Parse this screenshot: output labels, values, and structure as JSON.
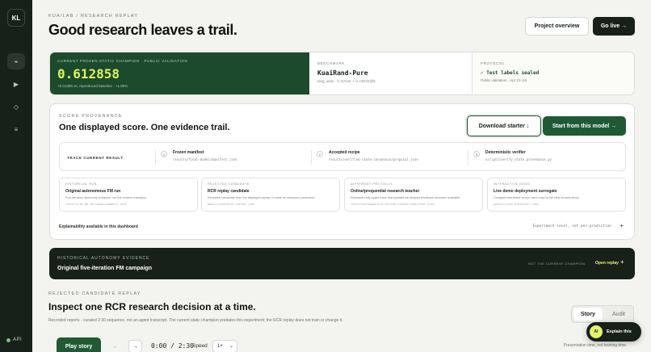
{
  "sidebar": {
    "logo": "KL",
    "items": [
      {
        "icon": "trail-icon",
        "glyph": "⌁"
      },
      {
        "icon": "play-icon",
        "glyph": "▶"
      },
      {
        "icon": "diamond-icon",
        "glyph": "◇"
      },
      {
        "icon": "list-icon",
        "glyph": "≡"
      }
    ],
    "api_label": "API",
    "api_status_color": "#6fc18b"
  },
  "header": {
    "breadcrumb": "KUAILAB / RESEARCH REPLAY",
    "title": "Good research leaves a trail.",
    "project_overview": "Project overview",
    "go_live": "Go live →"
  },
  "stats": {
    "champion_label": "CURRENT FROZEN STATIC CHAMPION · PUBLIC VALIDATION",
    "champion_value": "0.612858",
    "champion_sub": "+0.01386 vs. reproduced baseline · +1.86%",
    "benchmark_label": "BENCHMARK",
    "benchmark_value": "KuaiRand-Pure",
    "benchmark_sub": "long_view · ½ GAUC + ½ nDCG@5",
    "protocol_label": "PROTOCOL",
    "protocol_value": "✓ Test labels sealed",
    "protocol_sub": "Public validation · Apr 22–28"
  },
  "provenance": {
    "label": "SCORE PROVENANCE",
    "title": "One displayed score. One evidence trail.",
    "download": "Download starter ↓",
    "start": "Start from this model →",
    "trace_label": "TRACE CURRENT RESULT",
    "steps": [
      {
        "num": "1",
        "title": "Frozen manifest",
        "path": "results/final-model/manifest.json"
      },
      {
        "num": "2",
        "title": "Accepted recipe",
        "path": "results/verified-state-consensus/proposal.json"
      },
      {
        "num": "3",
        "title": "Deterministic verifier",
        "path": "scripts/verify_state_provenance.py"
      }
    ],
    "cards": [
      {
        "kicker": "HISTORICAL RUN",
        "title": "Original autonomous FM run",
        "desc": "Five-iteration autonomy evidence, not the current champion.",
        "path": "results/fm-0b-fm-sweep/summary.json"
      },
      {
        "kicker": "REJECTED CANDIDATE",
        "title": "RCR replay candidate",
        "desc": "Research candidate from the displayed replay; it made no champion promotion.",
        "path": "public/research-replay.json"
      },
      {
        "kicker": "DIFFERENT PROTOCOL",
        "title": "Online/prequential research teacher",
        "desc": "Research-only upper trace that updates as delayed feedback becomes available.",
        "path": "results/prequential-online-teacher/manifest.json"
      },
      {
        "kicker": "INTERACTIVE DEMO",
        "title": "Live demo deployment surrogate",
        "desc": "Compact interactive scorer used only by the click-to-rank demo.",
        "path": "public/live-predictor.json"
      }
    ],
    "explain": "Explainability available in this dashboard",
    "explain_note": "Experiment-level, not per-prediction",
    "expand": "+"
  },
  "autonomy": {
    "kicker": "HISTORICAL AUTONOMY EVIDENCE",
    "title": "Original five-iteration FM campaign",
    "note": "NOT THE CURRENT CHAMPION",
    "open": "Open replay",
    "expand": "+"
  },
  "replay": {
    "kicker": "REJECTED CANDIDATE REPLAY",
    "title": "Inspect one RCR research decision at a time.",
    "desc": "Recorded reports · curated 2:30 sequence, not an agent transcript. The current static champion predates this experiment; the RCR replay does not train or change it.",
    "tab_story": "Story",
    "tab_audit": "Audit",
    "play": "Play story",
    "prev": "←",
    "next": "→",
    "time": "0:00 / 2:30",
    "speed_label": "Speed",
    "speed_value": "1×",
    "footnote": "Presentation time, not training time"
  },
  "fab": {
    "badge": "AI",
    "label": "Explain this"
  }
}
